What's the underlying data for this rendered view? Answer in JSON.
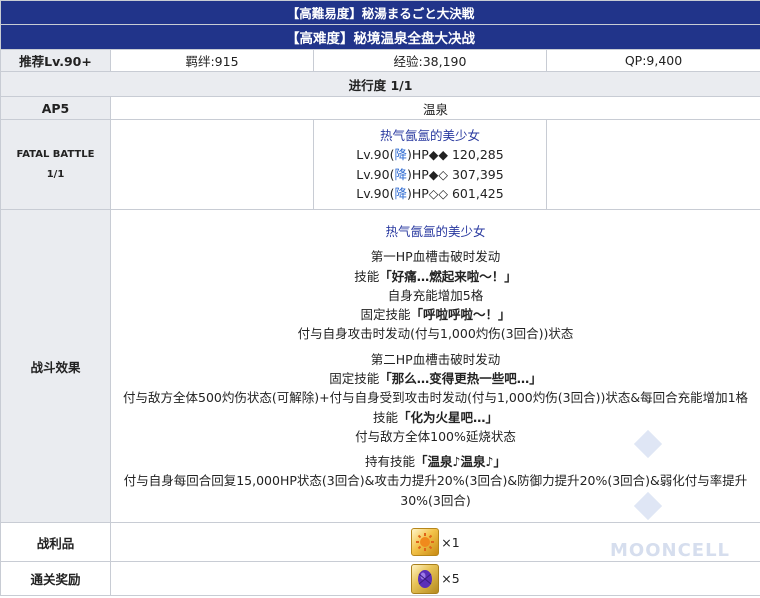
{
  "title_jp": "【高難易度】秘湯まるごと大決戦",
  "title_cn": "【高难度】秘境温泉全盘大决战",
  "recommend_label": "推荐Lv.90+",
  "bond": "羁绊:915",
  "exp": "经验:38,190",
  "qp": "QP:9,400",
  "progress": "进行度 1/1",
  "ap_label": "AP5",
  "location": "温泉",
  "fatal_label": "FATAL BATTLE",
  "fatal_count": "1/1",
  "enemy": {
    "name": "热气氤氲的美少女",
    "hp_rows": [
      {
        "pre": "Lv.90(",
        "down": "降",
        "post": ")HP◆◆ 120,285"
      },
      {
        "pre": "Lv.90(",
        "down": "降",
        "post": ")HP◆◇ 307,395"
      },
      {
        "pre": "Lv.90(",
        "down": "降",
        "post": ")HP◇◇ 601,425"
      }
    ]
  },
  "effect_label": "战斗效果",
  "effects": {
    "name": "热气氤氲的美少女",
    "g1": [
      "第一HP血槽击破时发动"
    ],
    "g1_skill_pre": "技能",
    "g1_skill": "「好痛…燃起来啦～！」",
    "g1_skill_desc": "自身充能增加5格",
    "g1_passive_pre": "固定技能",
    "g1_passive": "「呼啦呼啦～！」",
    "g1_passive_desc": "付与自身攻击时发动(付与1,000灼伤(3回合))状态",
    "g2_trigger": "第二HP血槽击破时发动",
    "g2_passive_pre": "固定技能",
    "g2_passive": "「那么…变得更热一些吧…」",
    "g2_passive_desc": "付与敌方全体500灼伤状态(可解除)+付与自身受到攻击时发动(付与1,000灼伤(3回合))状态&每回合充能增加1格",
    "g2_skill_pre": "技能",
    "g2_skill": "「化为火星吧…」",
    "g2_skill_desc": "付与敌方全体100%延烧状态",
    "g3_pre": "持有技能",
    "g3": "「温泉♪温泉♪」",
    "g3_desc1": "付与自身每回合回复15,000HP状态(3回合)&攻击力提升20%(3回合)&防御力提升20%(3回合)&弱化付与率提升",
    "g3_desc2": "30%(3回合)"
  },
  "loot_label": "战利品",
  "loot_qty": "×1",
  "reward_label": "通关奖励",
  "reward_qty": "×5",
  "watermark": "MOONCELL"
}
